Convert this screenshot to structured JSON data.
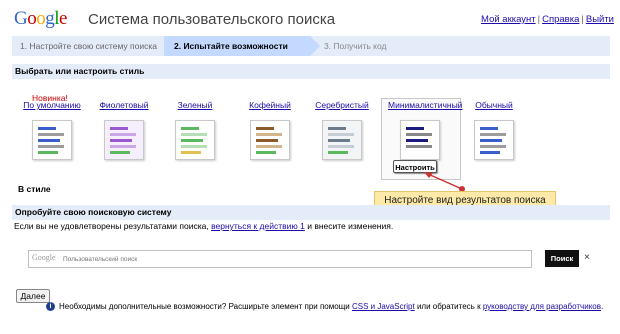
{
  "header": {
    "logo_text": "Google",
    "title": "Система пользовательского поиска",
    "links": [
      "Мой аккаунт",
      "Справка",
      "Выйти"
    ]
  },
  "steps": [
    "1. Настройте свою систему поиска",
    "2. Испытайте возможности",
    "3. Получить код"
  ],
  "style_section": {
    "heading": "Выбрать или настроить стиль",
    "new_label": "Новинка!",
    "styles": [
      {
        "name": "По умолчанию",
        "accent": "#3a5fcd"
      },
      {
        "name": "Фиолетовый",
        "accent": "#9b59d0"
      },
      {
        "name": "Зеленый",
        "accent": "#5cb85c"
      },
      {
        "name": "Кофейный",
        "accent": "#8b5a2b"
      },
      {
        "name": "Серебристый",
        "accent": "#9aa5b1"
      },
      {
        "name": "Минималистичный",
        "accent": "#1a1a80"
      },
      {
        "name": "Обычный",
        "accent": "#3a5fcd"
      }
    ],
    "configure_label": "Настроить",
    "in_style_label": "В стиле"
  },
  "callout": "Настройте вид результатов поиска",
  "test_section": {
    "heading": "Опробуйте свою поисковую систему",
    "text_before": "Если вы не удовлетворены результатами поиска,",
    "link": "вернуться к действию 1",
    "text_after": "и внесите изменения."
  },
  "search": {
    "brand": "Google",
    "placeholder": "Пользовательский поиск",
    "button_label": "Поиск",
    "clear_label": "×"
  },
  "next_label": "Далее",
  "info": {
    "icon": "i",
    "text_before": "Необходимы дополнительные возможности? Расширьте элемент при помощи",
    "link1": "CSS и JavaScript",
    "text_middle": "или обратитесь к",
    "link2": "руководству для разработчиков",
    "text_after": "."
  }
}
